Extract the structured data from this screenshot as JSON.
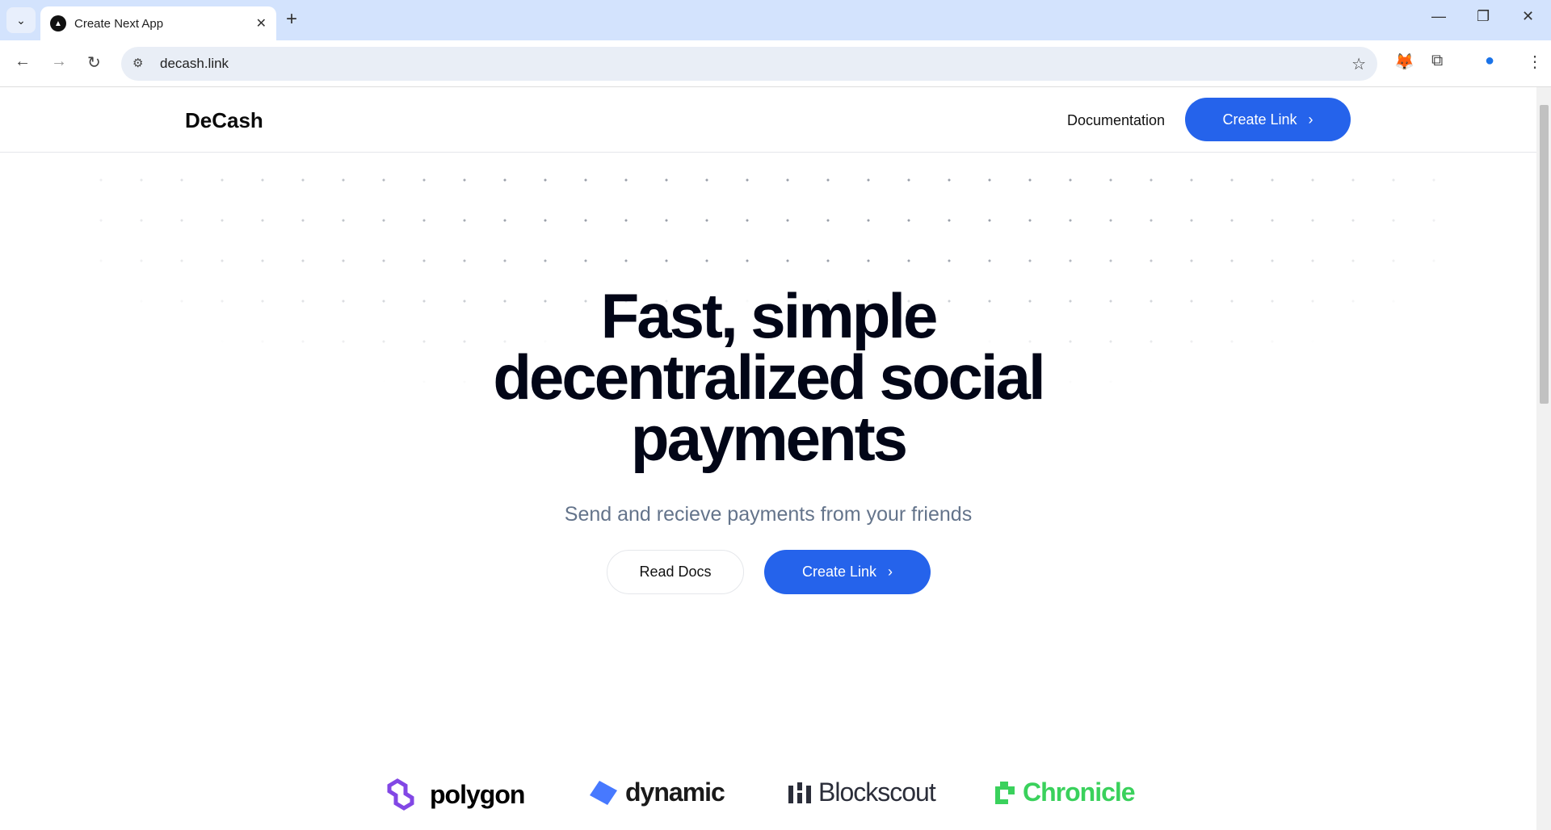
{
  "browser": {
    "tab_title": "Create Next App",
    "url": "decash.link"
  },
  "nav": {
    "brand": "DeCash",
    "documentation": "Documentation",
    "create_link": "Create Link"
  },
  "hero": {
    "line1": "Fast, simple",
    "line2": "decentralized social",
    "line3": "payments",
    "subtitle": "Send and recieve payments from your friends",
    "read_docs": "Read Docs",
    "create_link": "Create Link"
  },
  "partners": [
    {
      "name": "polygon",
      "color": "#8247e5",
      "icon": "polygon-icon"
    },
    {
      "name": "dynamic",
      "color": "#4779ff",
      "icon": "dynamic-icon"
    },
    {
      "name": "Blockscout",
      "color": "#2b2e3a",
      "icon": "blockscout-icon"
    },
    {
      "name": "Chronicle",
      "color": "#3ad15c",
      "icon": "chronicle-icon"
    }
  ],
  "colors": {
    "accent": "#2563eb",
    "heading": "#020617",
    "muted": "#64748b"
  }
}
